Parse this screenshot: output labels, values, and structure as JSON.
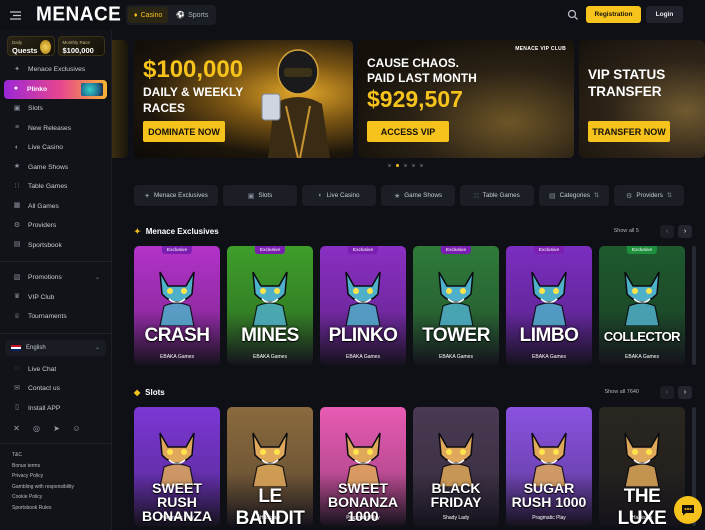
{
  "header": {
    "logo": "MENACE",
    "switch": [
      {
        "label": "Casino",
        "active": true
      },
      {
        "label": "Sports",
        "active": false
      }
    ],
    "register_label": "Registration",
    "login_label": "Login"
  },
  "sidebar": {
    "promos": [
      {
        "small": "Daily",
        "big": "Quests"
      },
      {
        "small": "Monthly Race",
        "big": "$100,000"
      }
    ],
    "nav": [
      {
        "label": "Menace Exclusives",
        "icon": "menace-icon"
      },
      {
        "label": "Plinko",
        "icon": "plinko-icon",
        "active": true
      },
      {
        "label": "Slots",
        "icon": "slots-icon"
      },
      {
        "label": "New Releases",
        "icon": "new-releases-icon"
      },
      {
        "label": "Live Casino",
        "icon": "live-casino-icon"
      },
      {
        "label": "Game Shows",
        "icon": "game-shows-icon"
      },
      {
        "label": "Table Games",
        "icon": "table-games-icon"
      },
      {
        "label": "All Games",
        "icon": "all-games-icon"
      },
      {
        "label": "Providers",
        "icon": "providers-icon"
      },
      {
        "label": "Sportsbook",
        "icon": "sportsbook-icon"
      }
    ],
    "nav2": [
      {
        "label": "Promotions",
        "icon": "promotions-icon",
        "chevron": true
      },
      {
        "label": "VIP Club",
        "icon": "vip-club-icon"
      },
      {
        "label": "Tournaments",
        "icon": "tournaments-icon"
      }
    ],
    "language": "English",
    "nav3": [
      {
        "label": "Live Chat",
        "icon": "live-chat-icon"
      },
      {
        "label": "Contact us",
        "icon": "contact-icon"
      },
      {
        "label": "Install APP",
        "icon": "install-app-icon"
      }
    ],
    "socials": [
      "x-icon",
      "instagram-icon",
      "telegram-icon",
      "discord-icon"
    ],
    "legal": [
      "T&C",
      "Bonus terms",
      "Privacy Policy",
      "Gambling with responsibility",
      "Cookie Policy",
      "Sportsbook Rules"
    ]
  },
  "banners": [
    {
      "big": "$100,000",
      "line1": "DAILY & WEEKLY",
      "line2": "RACES",
      "cta": "DOMINATE NOW"
    },
    {
      "tag": "MENACE VIP CLUB",
      "line1": "CAUSE CHAOS.",
      "line2": "PAID LAST MONTH",
      "big": "$929,507",
      "cta": "ACCESS VIP"
    },
    {
      "line1": "VIP STATUS",
      "line2": "TRANSFER",
      "cta": "TRANSFER NOW"
    }
  ],
  "carousel_dots": 5,
  "carousel_active": 1,
  "filters": [
    {
      "label": "Menace Exclusives",
      "icon": "menace-icon"
    },
    {
      "label": "Slots",
      "icon": "slots-icon"
    },
    {
      "label": "Live Casino",
      "icon": "live-casino-icon"
    },
    {
      "label": "Game Shows",
      "icon": "game-shows-icon"
    },
    {
      "label": "Table Games",
      "icon": "table-games-icon"
    },
    {
      "label": "Categories",
      "icon": "categories-icon"
    },
    {
      "label": "Providers",
      "icon": "providers-icon"
    }
  ],
  "exclusives": {
    "title": "Menace Exclusives",
    "show_all": "Show all 5",
    "games": [
      {
        "name": "CRASH",
        "provider": "EBAKA Games",
        "tag": "Exclusive",
        "color": "#b332c9"
      },
      {
        "name": "MINES",
        "provider": "EBAKA Games",
        "tag": "Exclusive",
        "color": "#3e9e2a"
      },
      {
        "name": "PLINKO",
        "provider": "EBAKA Games",
        "tag": "Exclusive",
        "color": "#8a2fc4"
      },
      {
        "name": "TOWER",
        "provider": "EBAKA Games",
        "tag": "Exclusive",
        "color": "#2f7a3a"
      },
      {
        "name": "LIMBO",
        "provider": "EBAKA Games",
        "tag": "Exclusive",
        "color": "#7b2dc0"
      },
      {
        "name": "COLLECTOR",
        "provider": "EBAKA Games",
        "tag": "Exclusive",
        "color": "#1f5a2e"
      }
    ]
  },
  "slots": {
    "title": "Slots",
    "show_all": "Show all 7640",
    "games": [
      {
        "name": "SWEET RUSH BONANZA",
        "provider": "Pragmatic Play",
        "color": "#7b37d4"
      },
      {
        "name": "LE BANDIT",
        "provider": "Hacksaw",
        "color": "#8a6a3e"
      },
      {
        "name": "SWEET BONANZA 1000",
        "provider": "Pragmatic Play",
        "color": "#e85bb4"
      },
      {
        "name": "BLACK FRIDAY",
        "provider": "Shady Lady",
        "color": "#4a3a52"
      },
      {
        "name": "SUGAR RUSH 1000",
        "provider": "Pragmatic Play",
        "color": "#8a52e0"
      },
      {
        "name": "THE LUXE",
        "provider": "Hacksaw",
        "color": "#2a2620"
      }
    ]
  }
}
